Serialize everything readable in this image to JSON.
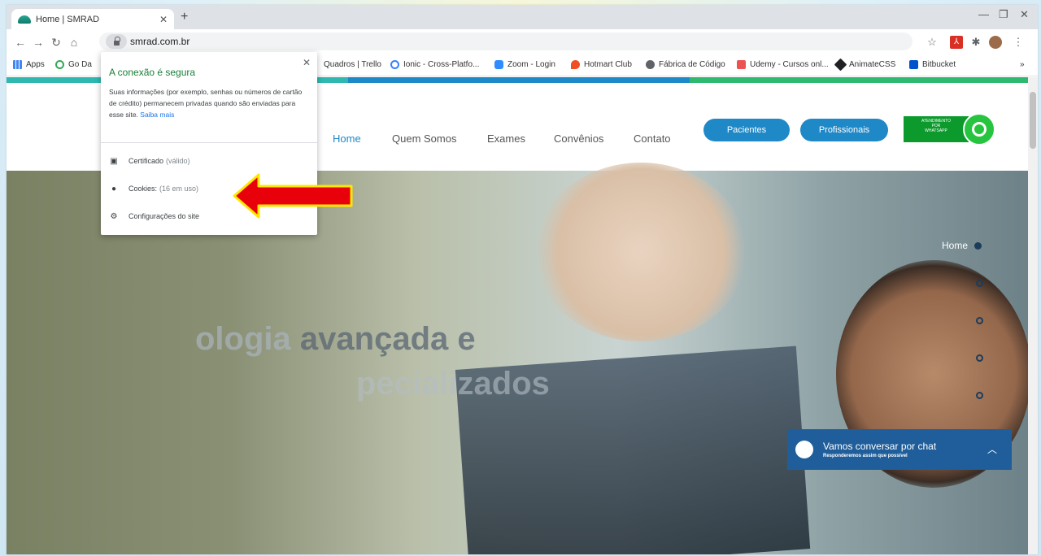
{
  "browser": {
    "tab_title": "Home | SMRAD",
    "url": "smrad.com.br",
    "bookmarks": [
      {
        "label": "Apps",
        "color": "#e94235"
      },
      {
        "label": "Go Da",
        "color": "#34a853"
      },
      {
        "label": "Quadros | Trello",
        "color": "#0079bf"
      },
      {
        "label": "Ionic - Cross-Platfo...",
        "color": "#3880ff"
      },
      {
        "label": "Zoom - Login",
        "color": "#2d8cff"
      },
      {
        "label": "Hotmart Club",
        "color": "#f04e23"
      },
      {
        "label": "Fábrica de Código",
        "color": "#5f6368"
      },
      {
        "label": "Udemy - Cursos onl...",
        "color": "#ec5252"
      },
      {
        "label": "AnimateCSS",
        "color": "#202124"
      },
      {
        "label": "Bitbucket",
        "color": "#0052cc"
      }
    ],
    "more_bookmarks": "»"
  },
  "popup": {
    "heading": "A conexão é segura",
    "description": "Suas informações (por exemplo, senhas ou números de cartão de crédito) permanecem privadas quando são enviadas para esse site.",
    "learn_more": "Saiba mais",
    "items": [
      {
        "label": "Certificado",
        "muted": "(válido)"
      },
      {
        "label": "Cookies:",
        "muted": "(16 em uso)"
      },
      {
        "label": "Configurações do site",
        "muted": ""
      }
    ]
  },
  "site": {
    "nav": [
      "Home",
      "Quem Somos",
      "Exames",
      "Convênios",
      "Contato"
    ],
    "buttons": [
      "Pacientes",
      "Profissionais"
    ],
    "whatsapp_lines": [
      "ATENDIMENTO",
      "POR",
      "WHATSAPP"
    ],
    "hero_title_part1": "ologia",
    "hero_title_part2": "avançada e",
    "hero_subtitle": "pecializados",
    "side_nav_label": "Home",
    "chat_title": "Vamos conversar por chat",
    "chat_subtitle": "Responderemos assim que possível"
  },
  "colors": {
    "accent_blue": "#1f88c7",
    "secure_green": "#188038",
    "whatsapp_green": "#0c9a2c",
    "arrow_red": "#e8000a",
    "arrow_yellow": "#ffe600"
  }
}
